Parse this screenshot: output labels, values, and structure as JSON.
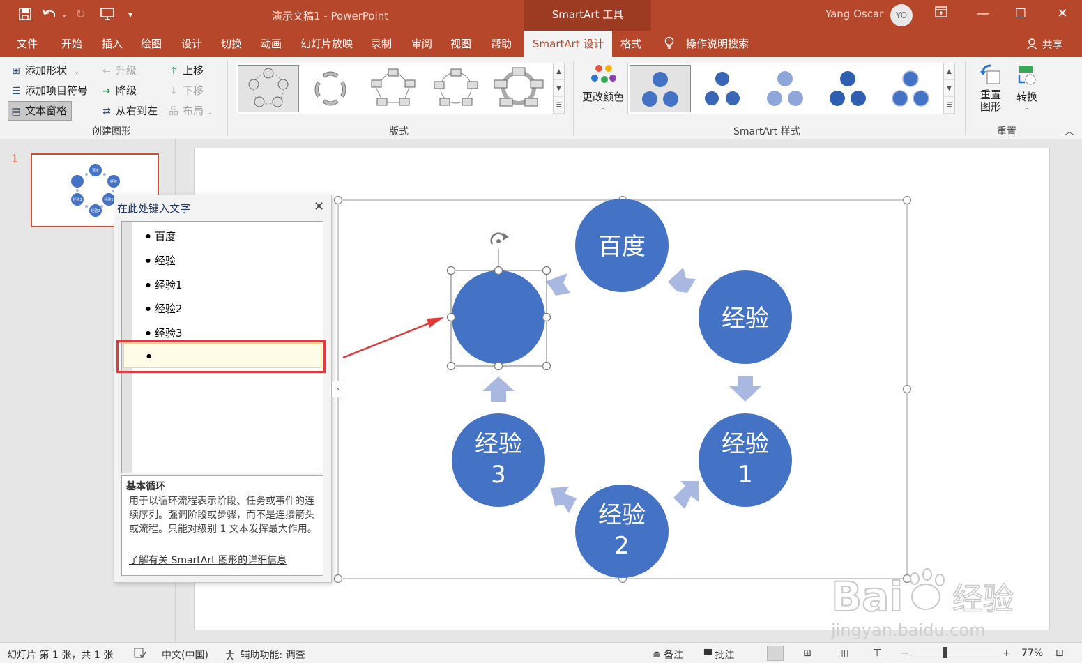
{
  "titlebar": {
    "doc_title": "演示文稿1  -  PowerPoint",
    "context_tab": "SmartArt 工具",
    "user_name": "Yang Oscar",
    "user_initials": "YO"
  },
  "tabs": {
    "file": "文件",
    "home": "开始",
    "insert": "插入",
    "draw": "绘图",
    "design": "设计",
    "transitions": "切换",
    "animations": "动画",
    "slideshow": "幻灯片放映",
    "record": "录制",
    "review": "审阅",
    "view": "视图",
    "help": "帮助",
    "smartart_design": "SmartArt 设计",
    "format": "格式",
    "search": "操作说明搜索",
    "share": "共享"
  },
  "ribbon": {
    "create": {
      "add_shape": "添加形状",
      "add_bullet": "添加项目符号",
      "text_pane": "文本窗格",
      "promote": "升级",
      "demote": "降级",
      "rtl": "从右到左",
      "move_up": "上移",
      "move_down": "下移",
      "layout": "布局",
      "group_label": "创建图形"
    },
    "layouts_label": "版式",
    "change_colors": "更改颜色",
    "styles_label": "SmartArt 样式",
    "reset": {
      "reset_graphic": "重置图形",
      "reset_line1": "重置",
      "reset_line2": "图形",
      "convert": "转换",
      "group_label": "重置"
    }
  },
  "thumbnail": {
    "number": "1",
    "labels": [
      "百度",
      "经验",
      "经验1",
      "经验2",
      "经验3"
    ]
  },
  "text_pane": {
    "header": "在此处键入文字",
    "items": [
      "百度",
      "经验",
      "经验1",
      "经验2",
      "经验3",
      ""
    ],
    "layout_name": "基本循环",
    "layout_desc": "用于以循环流程表示阶段、任务或事件的连续序列。强调阶段或步骤，而不是连接箭头或流程。只能对级别 1 文本发挥最大作用。",
    "learn_more": "了解有关 SmartArt 图形的详细信息"
  },
  "smartart": {
    "node_top": "百度",
    "node_right_upper": "经验",
    "node_right_lower_1": "经验",
    "node_right_lower_2": "1",
    "node_bottom_1": "经验",
    "node_bottom_2": "2",
    "node_left_lower_1": "经验",
    "node_left_lower_2": "3",
    "node_left_upper": "",
    "colors": {
      "node": "#4472c4",
      "arrow": "#a9b8e0",
      "accent": "#b7472a"
    }
  },
  "statusbar": {
    "slide_info": "幻灯片 第 1 张，共 1 张",
    "language": "中文(中国)",
    "accessibility": "辅助功能: 调查",
    "notes": "备注",
    "comments": "批注",
    "zoom": "77%"
  },
  "watermark": {
    "brand": "Bai",
    "brand2": "经验",
    "url": "jingyan.baidu.com"
  }
}
